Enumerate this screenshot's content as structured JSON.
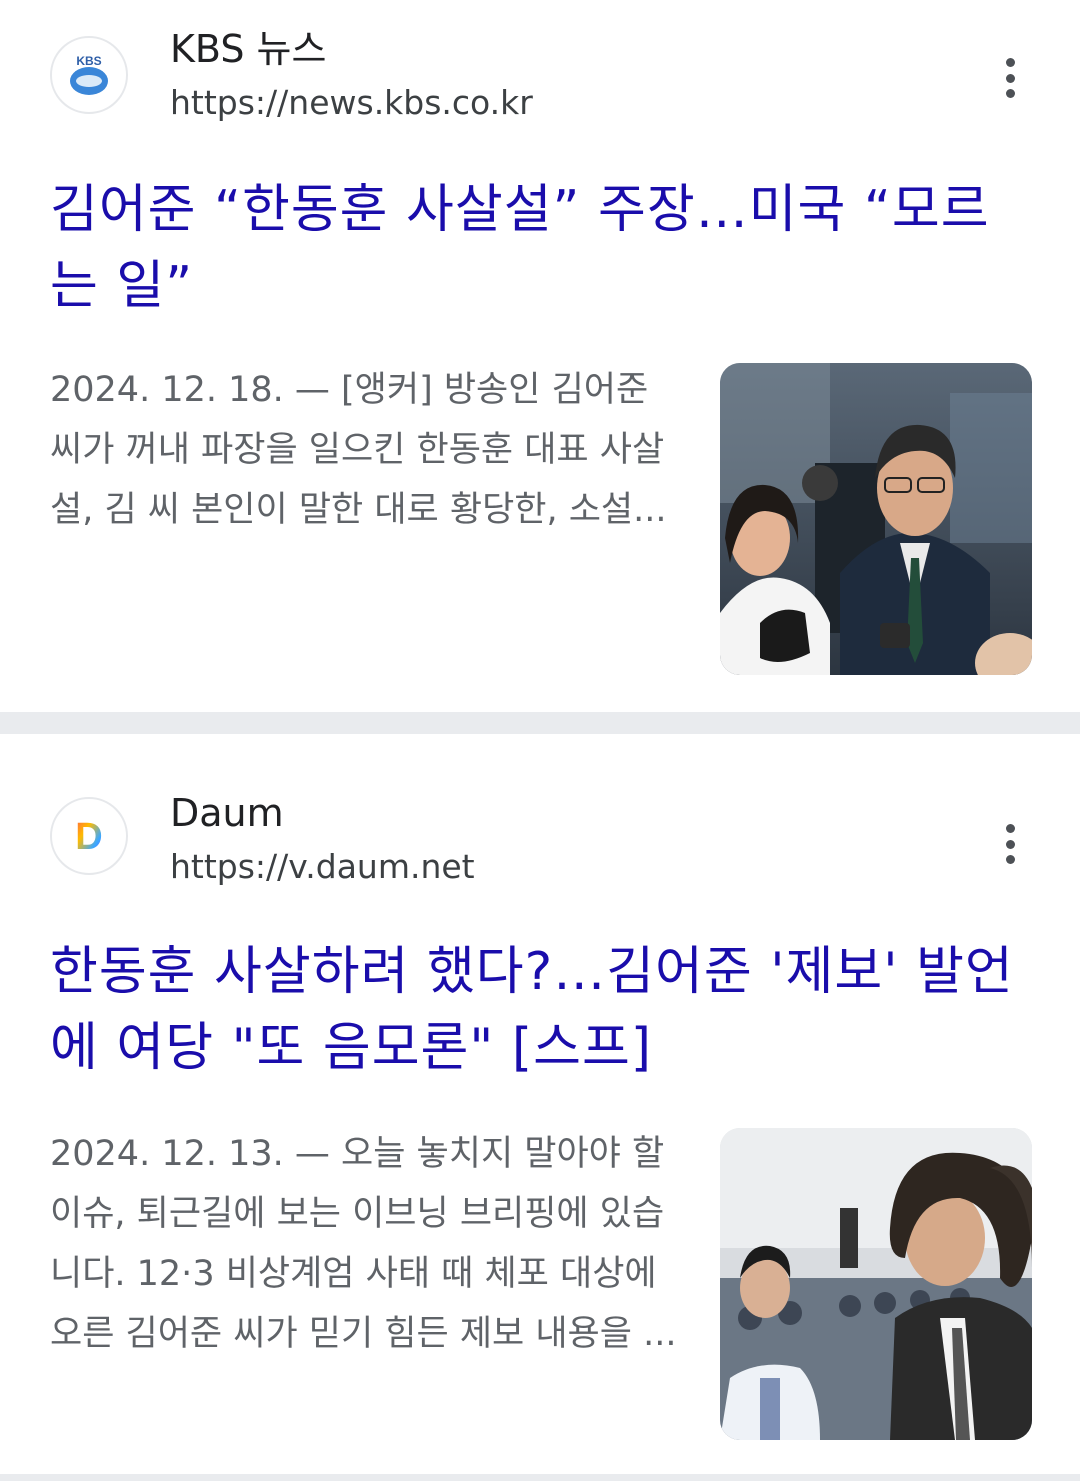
{
  "results": [
    {
      "source": {
        "name": "KBS 뉴스",
        "url": "https://news.kbs.co.kr",
        "favicon_text": "KBS",
        "favicon_icon": "kbs-logo-icon"
      },
      "headline": "김어준 “한동훈 사살설” 주장…미국 “모르는 일”",
      "snippet": "2024. 12. 18. — [앵커] 방송인 김어준 씨가 꺼내 파장을 일으킨 한동훈 대표 사살설, 김 씨 본인이 말한 대로 황당한, 소설...",
      "thumbnail_icon": "news-photo-thumbnail"
    },
    {
      "source": {
        "name": "Daum",
        "url": "https://v.daum.net",
        "favicon_text": "D",
        "favicon_icon": "daum-logo-icon"
      },
      "headline": "한동훈 사살하려 했다?…김어준 '제보' 발언에 여당 \"또 음모론\" [스프]",
      "snippet": "2024. 12. 13. — 오늘 놓치지 말아야 할 이슈, 퇴근길에 보는 이브닝 브리핑에 있습니다. 12·3 비상계엄 사태 때 체포 대상에 오른 김어준 씨가 믿기 힘든 제보 내용을 ...",
      "thumbnail_icon": "news-photo-thumbnail"
    }
  ],
  "colors": {
    "headline": "#1a0dab",
    "snippet": "#5f6368",
    "divider": "#e9ebee",
    "daum_gradient": [
      "#ff5a4e",
      "#ffbb00",
      "#3aa8ff",
      "#7b4dff"
    ],
    "kbs_blue": "#2f6fd6"
  },
  "icons": {
    "more": "more-vert-icon"
  }
}
